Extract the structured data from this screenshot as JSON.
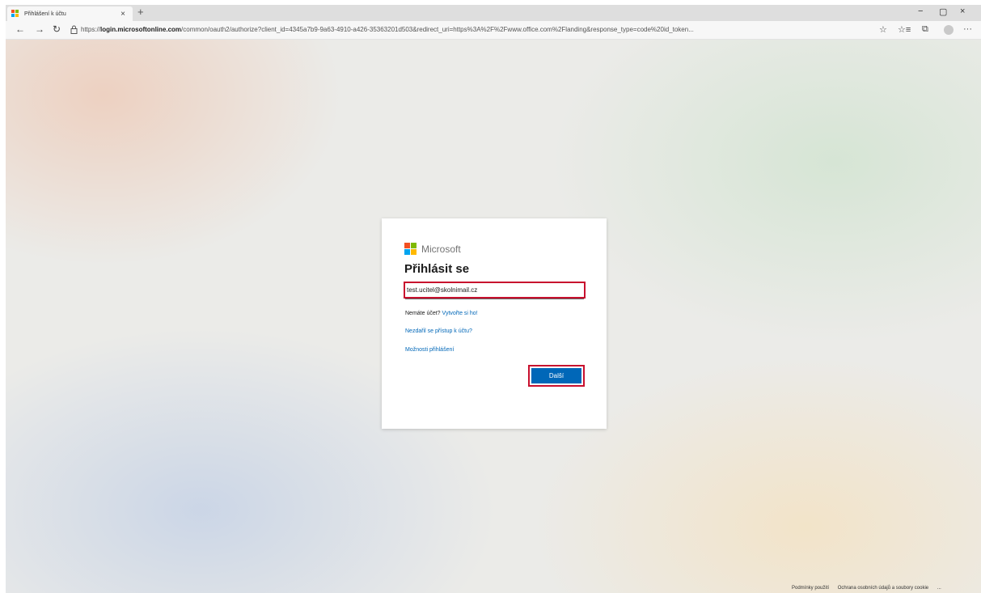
{
  "browser": {
    "tab_title": "Přihlášení k účtu",
    "tab_close_icon": "×",
    "new_tab_icon": "+",
    "window_controls": [
      "−",
      "▢",
      "×"
    ],
    "url_prefix": "https://",
    "url_host": "login.microsoftonline.com",
    "url_rest": "/common/oauth2/authorize?client_id=4345a7b9-9a63-4910-a426-35363201d503&redirect_uri=https%3A%2F%2Fwww.office.com%2Flanding&response_type=code%20id_token..."
  },
  "icons": {
    "back": "←",
    "forward": "→",
    "refresh": "↻",
    "lock": "🔒",
    "favorite": "☆",
    "favorites_bar": "☆≡",
    "collections": "⧉",
    "more": "···"
  },
  "brand_colors": {
    "ms_red": "#f25022",
    "ms_green": "#7fba00",
    "ms_blue": "#00a4ef",
    "ms_yellow": "#ffb900",
    "primary_button": "#0067b8",
    "highlight": "#c8102e"
  },
  "signin": {
    "logo_text": "Microsoft",
    "heading": "Přihlásit se",
    "email_value": "test.ucitel@skolnimail.cz",
    "no_account_text": "Nemáte účet?",
    "create_link": "Vytvořte si ho!",
    "cant_access_link": "Nezdařil se přístup k účtu?",
    "signin_options_link": "Možnosti přihlášení",
    "next_button": "Další"
  },
  "footer": {
    "terms": "Podmínky použití",
    "privacy": "Ochrana osobních údajů a soubory cookie",
    "more": "..."
  }
}
